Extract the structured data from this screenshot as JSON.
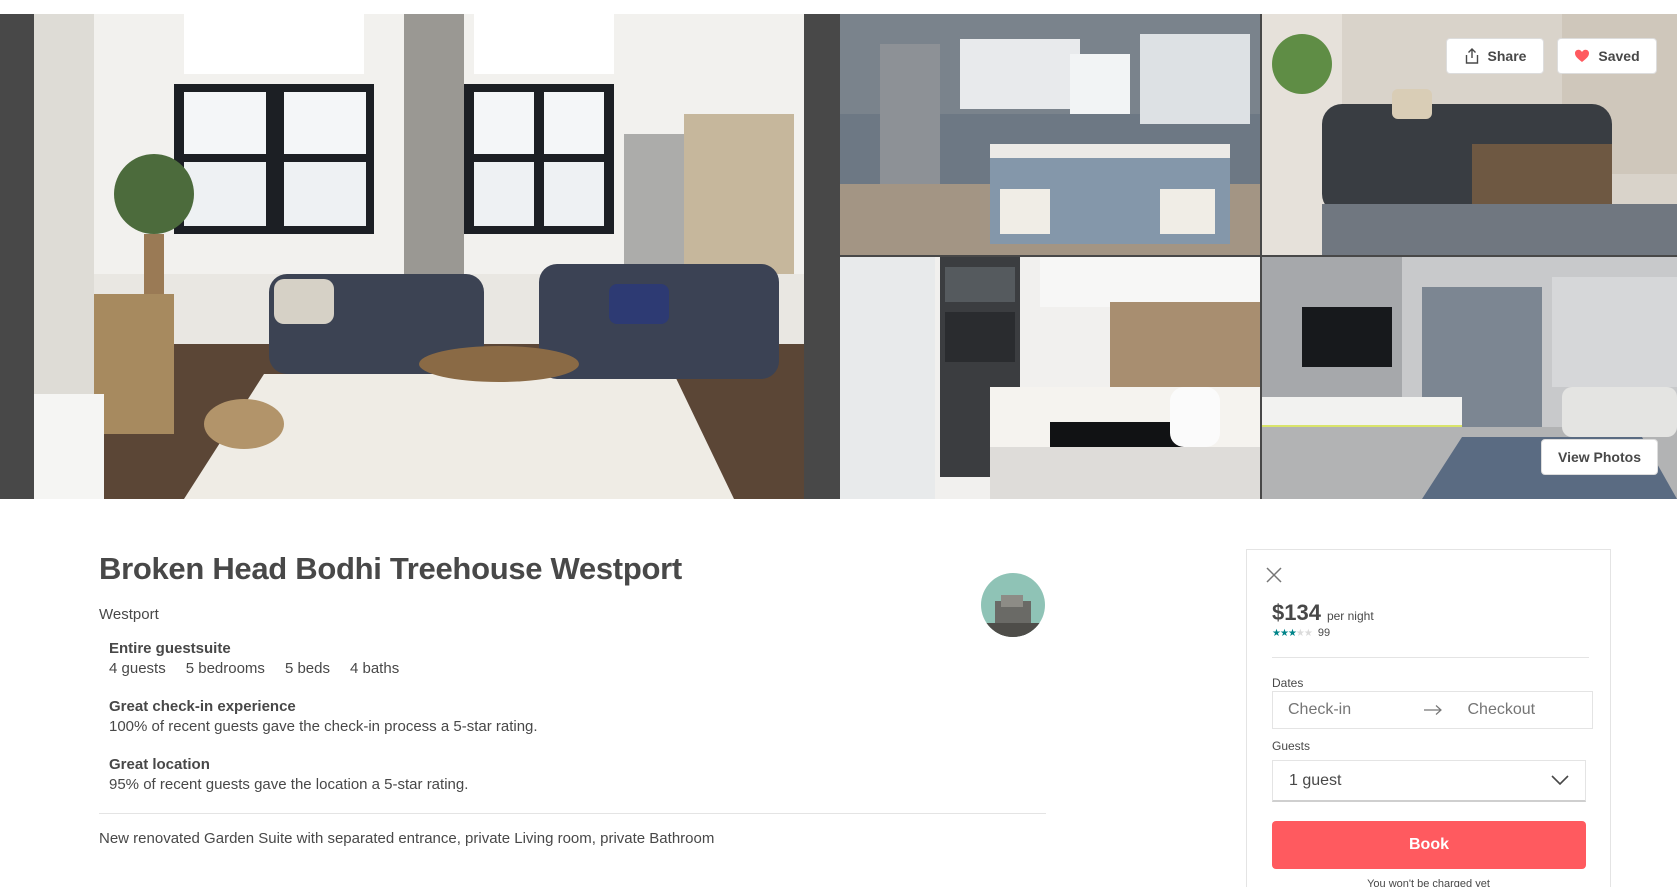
{
  "gallery": {
    "share_label": "Share",
    "saved_label": "Saved",
    "view_photos_label": "View Photos",
    "icons": {
      "share": "share-icon",
      "saved": "heart-icon"
    },
    "saved_heart_color": "#ff5a5f"
  },
  "listing": {
    "title": "Broken Head Bodhi Treehouse Westport",
    "city": "Westport",
    "summary": {
      "type": "Entire guestsuite",
      "facts": [
        "4 guests",
        "5 bedrooms",
        "5 beds",
        "4 baths"
      ]
    },
    "highlights": [
      {
        "heading": "Great check-in experience",
        "text": "100% of recent guests gave the check-in process a 5-star rating."
      },
      {
        "heading": "Great location",
        "text": "95% of recent guests gave the location a 5-star rating."
      }
    ],
    "description": "New renovated Garden Suite with separated entrance, private Living room, private Bathroom"
  },
  "booking": {
    "price": "$134",
    "per_night": "per night",
    "rating_stars": 2.5,
    "review_count": "99",
    "dates_label": "Dates",
    "checkin_placeholder": "Check-in",
    "checkout_placeholder": "Checkout",
    "guests_label": "Guests",
    "guests_value": "1 guest",
    "book_label": "Book",
    "not_charged": "You won't be charged yet",
    "accent_color": "#ff5a5f",
    "star_color": "#008489"
  }
}
